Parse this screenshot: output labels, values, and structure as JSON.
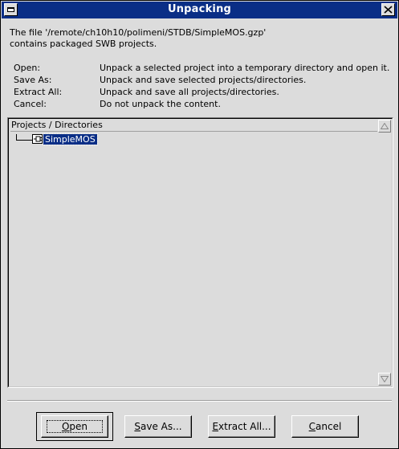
{
  "window": {
    "title": "Unpacking"
  },
  "message": {
    "line1": "The file '/remote/ch10h10/polimeni/STDB/SimpleMOS.gzp'",
    "line2": "contains packaged SWB projects."
  },
  "definitions": [
    {
      "key": "Open:",
      "desc": "Unpack a selected project into a temporary directory and open it."
    },
    {
      "key": "Save As:",
      "desc": "Unpack and save selected projects/directories."
    },
    {
      "key": "Extract All:",
      "desc": "Unpack and save all projects/directories."
    },
    {
      "key": "Cancel:",
      "desc": "Do not unpack the content."
    }
  ],
  "tree": {
    "header": "Projects / Directories",
    "items": [
      {
        "label": "SimpleMOS",
        "icon": "project-icon",
        "selected": true
      }
    ]
  },
  "buttons": {
    "open": {
      "mnemonic": "O",
      "rest": "pen"
    },
    "save_as": {
      "pre": "S",
      "rest": "ave As..."
    },
    "extract_all": {
      "pre": "E",
      "rest": "xtract All..."
    },
    "cancel": {
      "pre": "C",
      "rest": "ancel"
    }
  }
}
